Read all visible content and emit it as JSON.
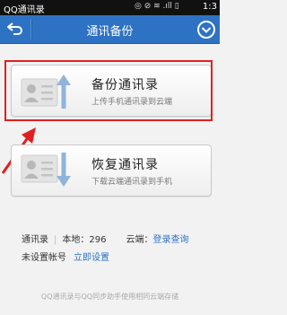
{
  "status_bar": {
    "app_name": "QQ通讯录",
    "icons": "◎ ⊘ ≋ .ıll ▯",
    "time": "1:3"
  },
  "header": {
    "title": "通讯备份"
  },
  "backup_card": {
    "title": "备份通讯录",
    "subtitle": "上传手机通讯录到云端"
  },
  "restore_card": {
    "title": "恢复通讯录",
    "subtitle": "下载云端通讯录到手机"
  },
  "info": {
    "contacts_label": "通讯录",
    "local_label": "本地：",
    "local_count": "296",
    "cloud_label": "云端：",
    "cloud_link": "登录查询",
    "account_status": "未设置帐号",
    "setup_link": "立即设置"
  },
  "footer": {
    "text": "QQ通讯录与QQ同步助手使用相同云端存储"
  },
  "colors": {
    "title_bar": "#2e72c3",
    "link": "#2c72c7",
    "highlight": "#e02020"
  }
}
